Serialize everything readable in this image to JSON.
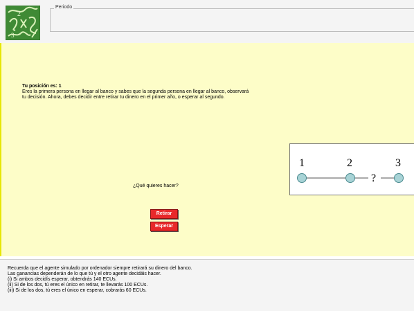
{
  "header": {
    "period_legend": "Periodo"
  },
  "main": {
    "position_title": "Tu posición es: 1",
    "instruction_line1": "Eres la primera persona en llegar al banco y sabes que la segunda persona en llegar al banco, observará",
    "instruction_line2": "tu decisión. Ahora, debes decidir entre retirar tu dinero en el primer año, o esperar al segundo.",
    "question": "¿Qué quieres hacer?",
    "retirar_label": "Retirar",
    "esperar_label": "Esperar"
  },
  "diagram": {
    "node1": "1",
    "node2": "2",
    "node3": "3",
    "unknown": "?"
  },
  "footer": {
    "line1": "Recuerda que el agente simulado por ordenador siempre retirará su dinero del banco.",
    "line2": "Las ganancias dependerán de lo que tú y el otro agente decidáis hacer.",
    "line3": "(i) Si ambos decidís esperar, obtendrás 140 ECUs.",
    "line4": "(ii) Si de los dos, tú eres el único en retirar, te llevarás 100 ECUs.",
    "line5": "(iii) Si de los dos, tú eres el único en esperar, cobrarás 60 ECUs."
  },
  "colors": {
    "main_background": "#fdfdc8",
    "button_red": "#e8282a",
    "logo_green": "#3f8a35",
    "node_fill": "#a8d3d6"
  }
}
